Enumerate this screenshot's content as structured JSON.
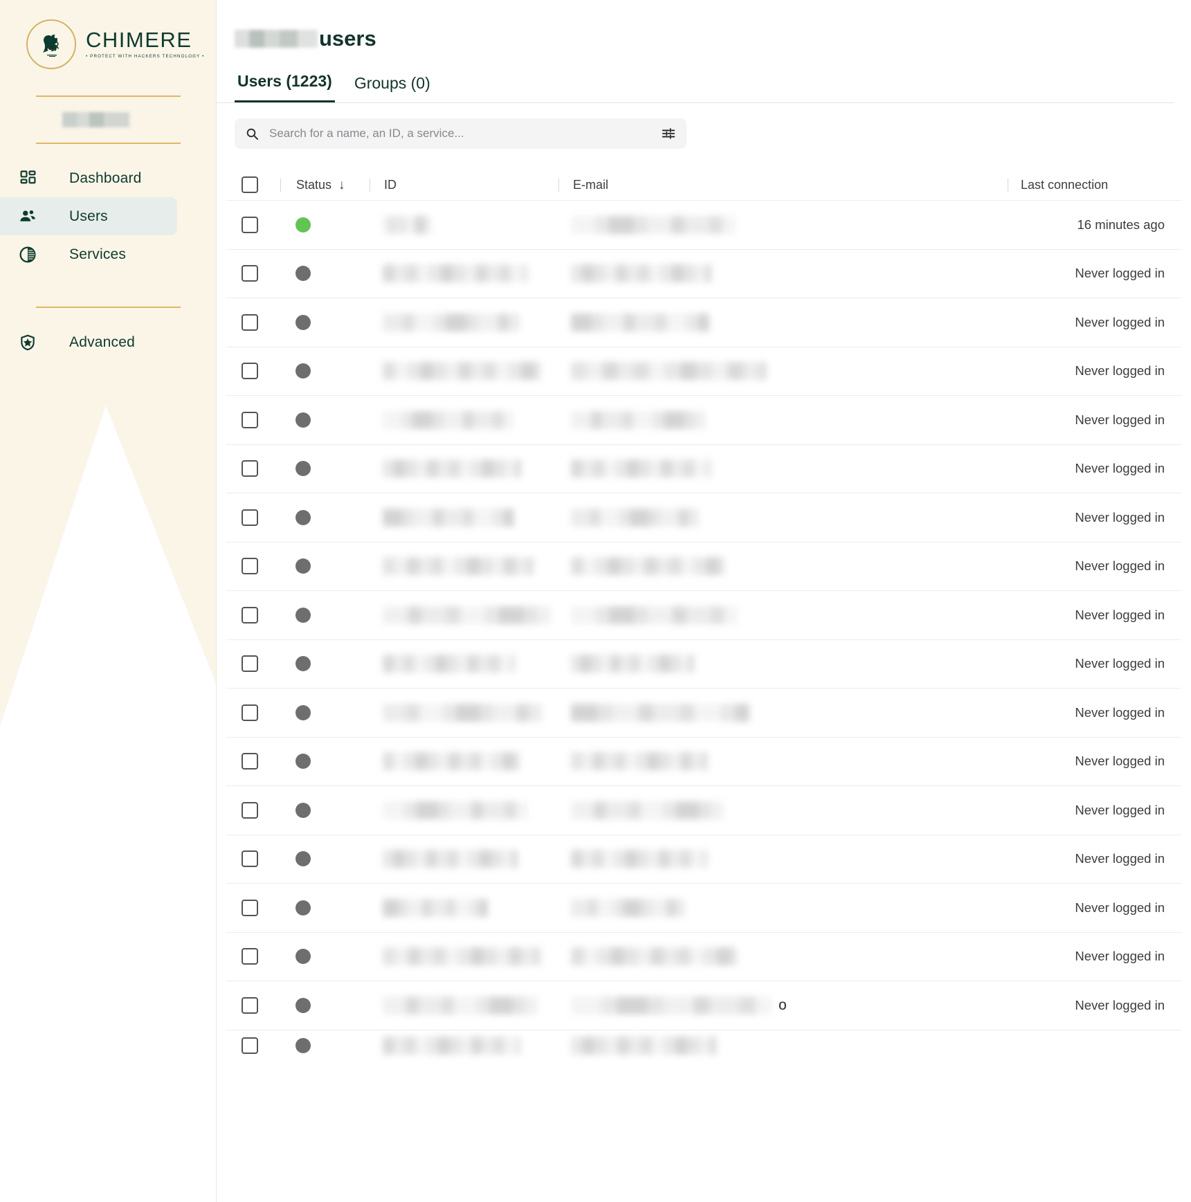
{
  "brand": {
    "name": "CHIMERE",
    "tagline": "• PROTECT WITH HACKERS TECHNOLOGY •",
    "logo_icon": "griffin-crest-icon",
    "accent_gold": "#dfb861",
    "dark_green": "#0d3b2e",
    "cream": "#fbf5e8"
  },
  "sidebar": {
    "org_label": "",
    "items": [
      {
        "label": "Dashboard",
        "icon": "dashboard-grid-icon",
        "active": false
      },
      {
        "label": "Users",
        "icon": "users-icon",
        "active": true
      },
      {
        "label": "Services",
        "icon": "half-circle-services-icon",
        "active": false
      },
      {
        "label": "Advanced",
        "icon": "shield-star-icon",
        "active": false
      }
    ]
  },
  "page": {
    "title_suffix": "users",
    "title_prefix_redacted": true
  },
  "tabs": [
    {
      "label": "Users (1223)",
      "active": true
    },
    {
      "label": "Groups (0)",
      "active": false
    }
  ],
  "search": {
    "placeholder": "Search for a name, an ID, a service...",
    "value": "",
    "search_icon": "search-icon",
    "filter_icon": "filter-sliders-icon"
  },
  "table": {
    "columns": [
      {
        "key": "select",
        "label": ""
      },
      {
        "key": "status",
        "label": "Status",
        "sort": "desc",
        "sort_glyph": "↓"
      },
      {
        "key": "id",
        "label": "ID"
      },
      {
        "key": "email",
        "label": "E-mail"
      },
      {
        "key": "last_connection",
        "label": "Last connection"
      }
    ],
    "rows": [
      {
        "checked": false,
        "status": "green",
        "id_redacted": true,
        "email_redacted": true,
        "last_connection": "16 minutes ago",
        "id_w": 70,
        "email_w": 238
      },
      {
        "checked": false,
        "status": "gray",
        "id_redacted": true,
        "email_redacted": true,
        "last_connection": "Never logged in",
        "id_w": 210,
        "email_w": 203
      },
      {
        "checked": false,
        "status": "gray",
        "id_redacted": true,
        "email_redacted": true,
        "last_connection": "Never logged in",
        "id_w": 198,
        "email_w": 200
      },
      {
        "checked": false,
        "status": "gray",
        "id_redacted": true,
        "email_redacted": true,
        "last_connection": "Never logged in",
        "id_w": 228,
        "email_w": 283
      },
      {
        "checked": false,
        "status": "gray",
        "id_redacted": true,
        "email_redacted": true,
        "last_connection": "Never logged in",
        "id_w": 190,
        "email_w": 195
      },
      {
        "checked": false,
        "status": "gray",
        "id_redacted": true,
        "email_redacted": true,
        "last_connection": "Never logged in",
        "id_w": 200,
        "email_w": 203
      },
      {
        "checked": false,
        "status": "gray",
        "id_redacted": true,
        "email_redacted": true,
        "last_connection": "Never logged in",
        "id_w": 190,
        "email_w": 185
      },
      {
        "checked": false,
        "status": "gray",
        "id_redacted": true,
        "email_redacted": true,
        "last_connection": "Never logged in",
        "id_w": 218,
        "email_w": 222
      },
      {
        "checked": false,
        "status": "gray",
        "id_redacted": true,
        "email_redacted": true,
        "last_connection": "Never logged in",
        "id_w": 243,
        "email_w": 241
      },
      {
        "checked": false,
        "status": "gray",
        "id_redacted": true,
        "email_redacted": true,
        "last_connection": "Never logged in",
        "id_w": 192,
        "email_w": 178
      },
      {
        "checked": false,
        "status": "gray",
        "id_redacted": true,
        "email_redacted": true,
        "last_connection": "Never logged in",
        "id_w": 230,
        "email_w": 258
      },
      {
        "checked": false,
        "status": "gray",
        "id_redacted": true,
        "email_redacted": true,
        "last_connection": "Never logged in",
        "id_w": 198,
        "email_w": 198
      },
      {
        "checked": false,
        "status": "gray",
        "id_redacted": true,
        "email_redacted": true,
        "last_connection": "Never logged in",
        "id_w": 210,
        "email_w": 220
      },
      {
        "checked": false,
        "status": "gray",
        "id_redacted": true,
        "email_redacted": true,
        "last_connection": "Never logged in",
        "id_w": 195,
        "email_w": 198
      },
      {
        "checked": false,
        "status": "gray",
        "id_redacted": true,
        "email_redacted": true,
        "last_connection": "Never logged in",
        "id_w": 152,
        "email_w": 165
      },
      {
        "checked": false,
        "status": "gray",
        "id_redacted": true,
        "email_redacted": true,
        "last_connection": "Never logged in",
        "id_w": 228,
        "email_w": 240
      },
      {
        "checked": false,
        "status": "gray",
        "id_redacted": true,
        "email_redacted": true,
        "last_connection": "Never logged in",
        "id_w": 224,
        "email_w": 290,
        "leak_char": "o"
      },
      {
        "checked": false,
        "status": "gray",
        "id_redacted": true,
        "email_redacted": true,
        "last_connection": "",
        "id_w": 200,
        "email_w": 210,
        "partial": true
      }
    ]
  }
}
